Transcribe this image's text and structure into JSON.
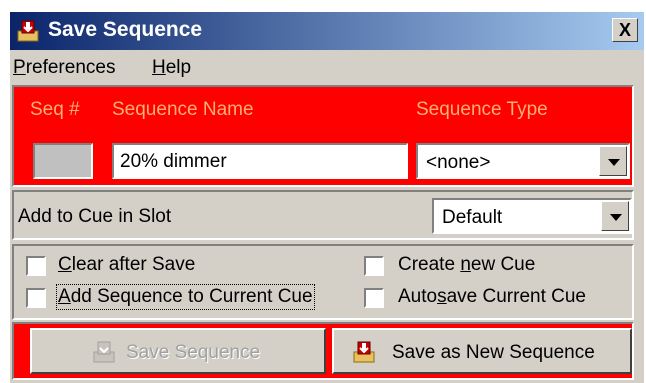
{
  "window": {
    "title": "Save Sequence",
    "close_label": "X"
  },
  "menu": {
    "preferences_first": "P",
    "preferences_rest": "references",
    "help_first": "H",
    "help_rest": "elp"
  },
  "sequence": {
    "seq_num_label": "Seq #",
    "name_label": "Sequence Name",
    "type_label": "Sequence Type",
    "name_value": "20% dimmer",
    "type_value": "<none>",
    "seq_num_value": ""
  },
  "slot": {
    "label": "Add to Cue in Slot",
    "value": "Default"
  },
  "options": {
    "clear_after_save_first": "C",
    "clear_after_save_rest": "lear after Save",
    "clear_after_save_checked": false,
    "add_to_current_cue_first": "A",
    "add_to_current_cue_rest": "dd Sequence to Current Cue",
    "add_to_current_cue_checked": false,
    "create_new_cue_pre": "Create ",
    "create_new_cue_u": "n",
    "create_new_cue_post": "ew Cue",
    "create_new_cue_checked": false,
    "autosave_pre": "Auto",
    "autosave_u": "s",
    "autosave_post": "ave Current Cue",
    "autosave_checked": false
  },
  "buttons": {
    "save_sequence": "Save Sequence",
    "save_sequence_disabled": true,
    "save_as_new": "Save as New Sequence"
  },
  "colors": {
    "panel_red": "#ff0000",
    "header_text": "#ffb070",
    "titlebar_start": "#0a246a",
    "titlebar_end": "#a6caf0"
  }
}
